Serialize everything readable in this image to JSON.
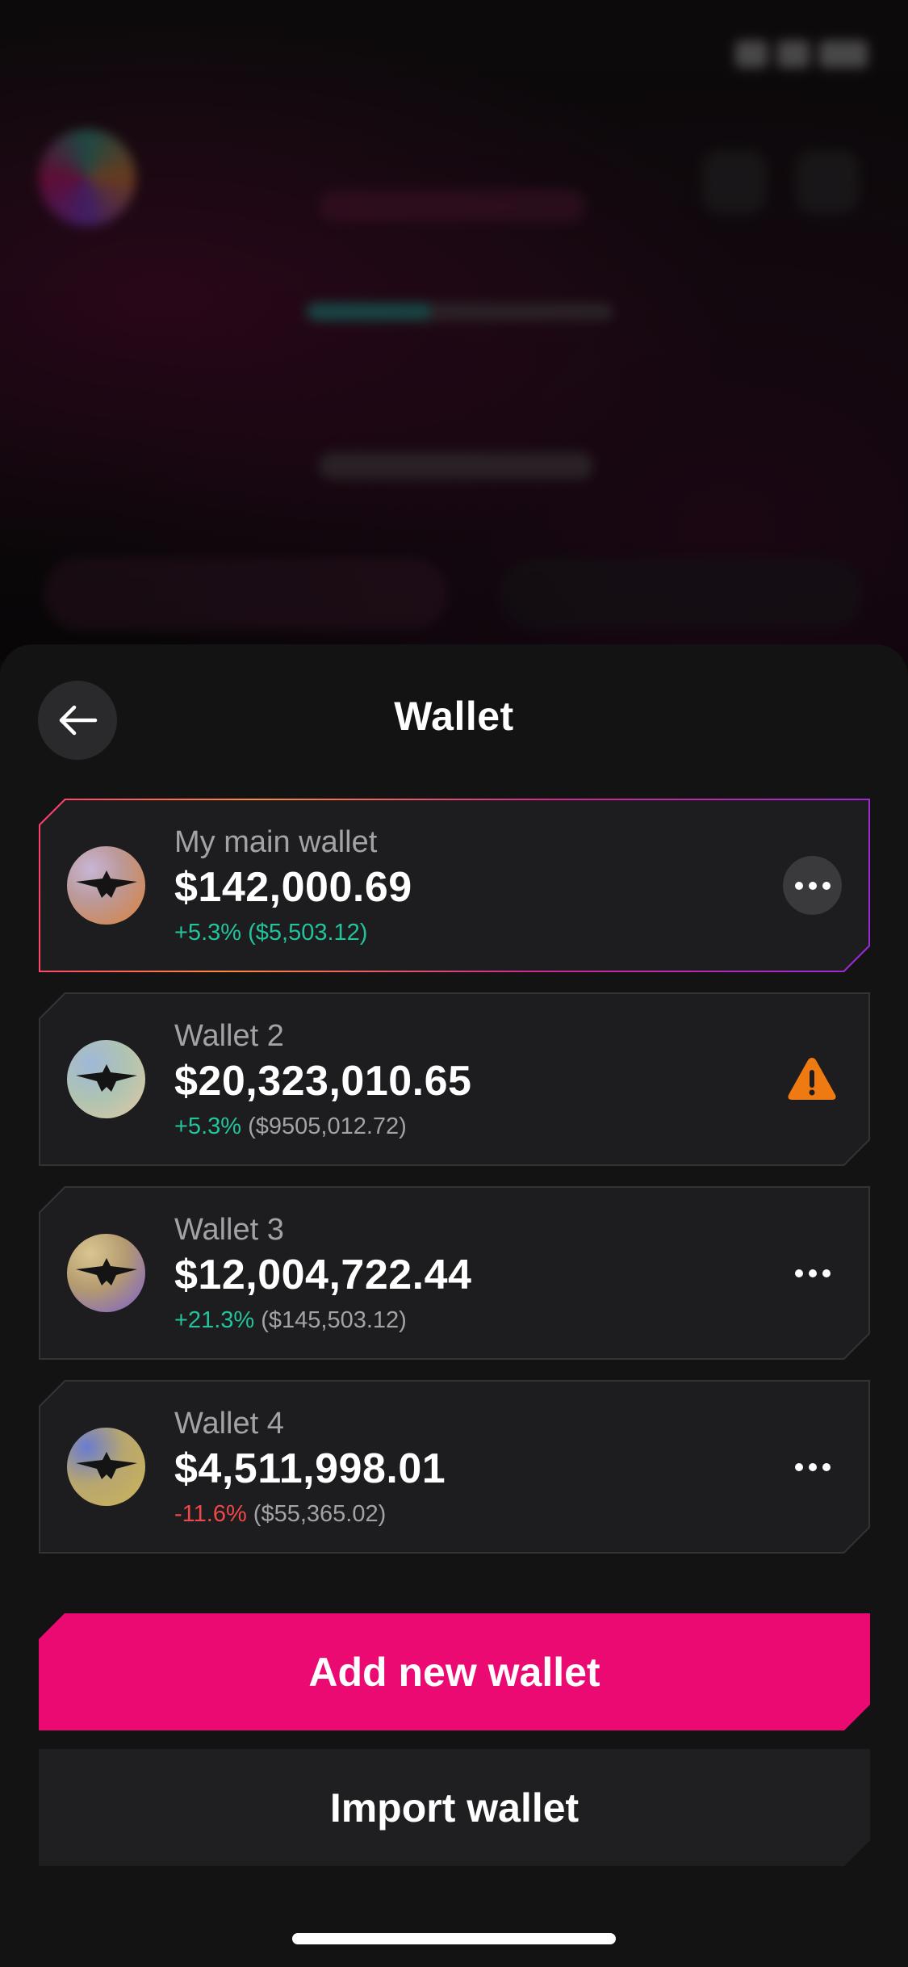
{
  "sheet": {
    "title": "Wallet",
    "back_icon": "arrow-left-icon"
  },
  "wallets": [
    {
      "name": "My main wallet",
      "balance": "$142,000.69",
      "change_pct": "+5.3%",
      "change_amount": "($5,503.12)",
      "trend": "positive",
      "action_icon": "more-icon",
      "selected": true
    },
    {
      "name": "Wallet 2",
      "balance": "$20,323,010.65",
      "change_pct": "+5.3%",
      "change_amount": "($9505,012.72)",
      "trend": "positive",
      "action_icon": "warning-icon",
      "selected": false
    },
    {
      "name": "Wallet 3",
      "balance": "$12,004,722.44",
      "change_pct": "+21.3%",
      "change_amount": "($145,503.12)",
      "trend": "positive",
      "action_icon": "more-icon",
      "selected": false
    },
    {
      "name": "Wallet 4",
      "balance": "$4,511,998.01",
      "change_pct": "-11.6%",
      "change_amount": "($55,365.02)",
      "trend": "negative",
      "action_icon": "more-icon",
      "selected": false
    }
  ],
  "actions": {
    "add_wallet_label": "Add new wallet",
    "import_wallet_label": "Import wallet"
  },
  "colors": {
    "accent": "#ea0a72",
    "positive": "#22c39d",
    "negative": "#ef4848",
    "warning": "#f07a12",
    "sheet_bg": "#131314",
    "card_bg": "#1d1c1e"
  }
}
